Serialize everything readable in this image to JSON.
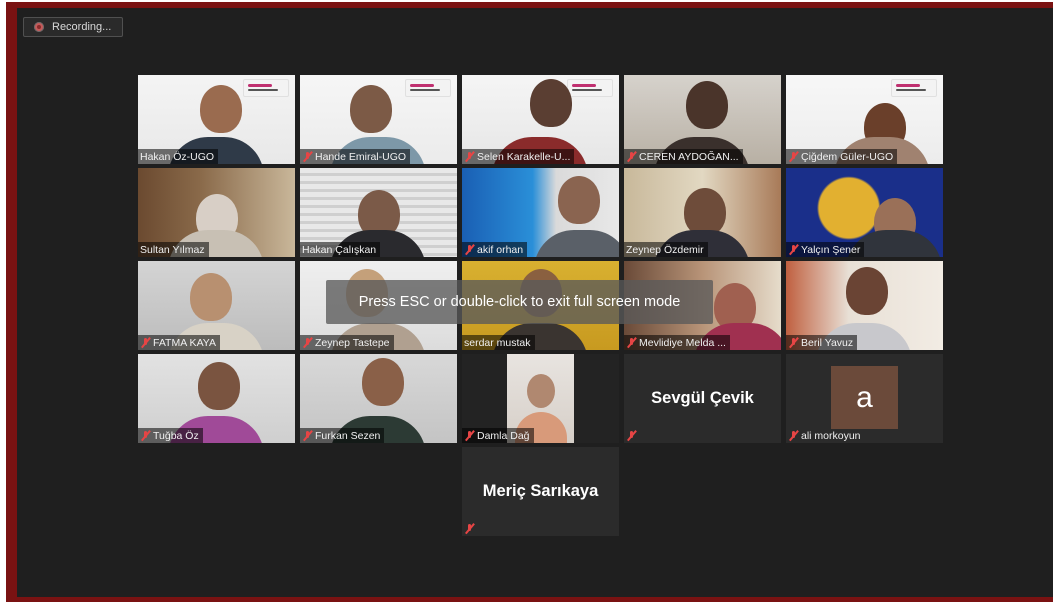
{
  "recording": {
    "label": "Recording...",
    "icon": "record-dot-icon"
  },
  "overlay": {
    "message": "Press ESC or double-click to exit full screen mode"
  },
  "participants": [
    {
      "name": "Hakan Öz-UGO",
      "muted": false
    },
    {
      "name": "Hande Emiral-UGO",
      "muted": true
    },
    {
      "name": "Selen Karakelle-U...",
      "muted": true
    },
    {
      "name": "CEREN AYDOĞAN...",
      "muted": true
    },
    {
      "name": "Çiğdem Güler-UGO",
      "muted": true
    },
    {
      "name": "Sultan Yılmaz",
      "muted": false
    },
    {
      "name": "Hakan Çalışkan",
      "muted": false,
      "active_speaker": true
    },
    {
      "name": "akif orhan",
      "muted": true
    },
    {
      "name": "Zeynep Özdemir",
      "muted": false
    },
    {
      "name": "Yalçın Şener",
      "muted": true
    },
    {
      "name": "FATMA KAYA",
      "muted": true
    },
    {
      "name": "Zeynep Tastepe",
      "muted": true
    },
    {
      "name": "serdar mustak",
      "muted": false
    },
    {
      "name": "Mevlidiye Melda ...",
      "muted": true
    },
    {
      "name": "Beril Yavuz",
      "muted": true
    },
    {
      "name": "Tuğba Öz",
      "muted": true
    },
    {
      "name": "Furkan Sezen",
      "muted": true
    },
    {
      "name": "Damla  Dağ",
      "muted": true
    },
    {
      "name": "Sevgül Çevik",
      "muted": true,
      "video_off": true
    },
    {
      "name": "ali morkoyun",
      "muted": true,
      "avatar_letter": "a"
    },
    {
      "name": "Meriç Sarıkaya",
      "muted": true,
      "video_off": true
    }
  ],
  "colors": {
    "frame": "#7a1212",
    "background": "#1f1f1f",
    "active_border": "#b9d36a",
    "mute_icon": "#e64545"
  }
}
